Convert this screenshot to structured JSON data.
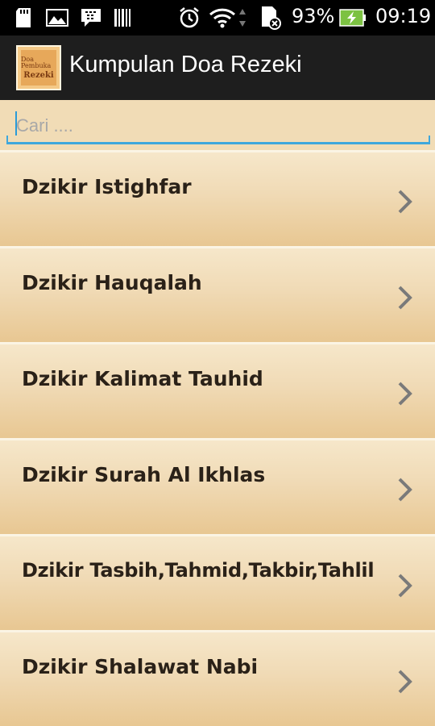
{
  "status_bar": {
    "battery_percent": "93%",
    "time": "09:19",
    "icons": [
      "sd-card-icon",
      "image-icon",
      "bbm-icon",
      "barcode-icon",
      "alarm-icon",
      "wifi-icon",
      "data-arrows-icon",
      "sim-off-icon",
      "battery-charging-icon"
    ]
  },
  "action_bar": {
    "app_icon_line1": "Doa Pembuka",
    "app_icon_line2": "Rezeki",
    "title": "Kumpulan Doa Rezeki"
  },
  "search": {
    "placeholder": "Cari ...."
  },
  "list": {
    "items": [
      {
        "label": "Dzikir Istighfar"
      },
      {
        "label": "Dzikir Hauqalah"
      },
      {
        "label": "Dzikir Kalimat Tauhid"
      },
      {
        "label": "Dzikir Surah Al Ikhlas"
      },
      {
        "label": "Dzikir Tasbih,Tahmid,Takbir,Tahlil"
      },
      {
        "label": "Dzikir Shalawat Nabi"
      }
    ],
    "chevron_icon": "chevron-right-icon"
  },
  "colors": {
    "status_bar_bg": "#000000",
    "action_bar_bg": "#1e1e1e",
    "list_bg": "#f1dcb6",
    "accent": "#3fa7dc",
    "battery": "#7cc242"
  }
}
